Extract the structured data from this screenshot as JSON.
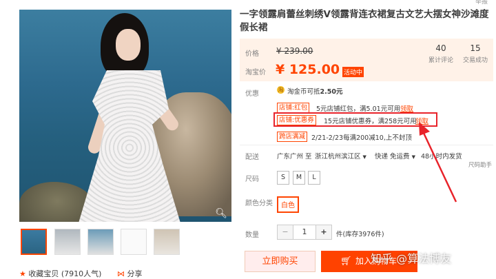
{
  "gallery": {
    "fav_label": "收藏宝贝 (7910人气)",
    "share_label": "分享",
    "thumbnails": [
      "thumb-1",
      "thumb-2",
      "thumb-3",
      "thumb-4",
      "thumb-5"
    ]
  },
  "product": {
    "title": "一字领露肩蕾丝刺绣V领露背连衣裙复古文艺大摆女神沙滩度假长裙",
    "price_label": "价格",
    "old_price": "¥ 239.00",
    "taobao_price_label": "淘宝价",
    "price": "¥ 125.00",
    "promo_badge": "活动中",
    "reviews_count": "40",
    "reviews_label": "累计评论",
    "trades_count": "15",
    "trades_label": "交易成功"
  },
  "benefits": {
    "label": "优惠",
    "coin_text_prefix": "淘金币可抵",
    "coin_value": "2.50元",
    "coupons": [
      {
        "tag": "店铺:红包",
        "text": "5元店铺红包，满5.01元可用",
        "link": "领取"
      },
      {
        "tag": "店铺:优惠券",
        "text": "15元店铺优惠券，满258元可用",
        "link": "领取"
      },
      {
        "tag": "跨店满减",
        "text": "2/21-2/23每满200减10,上不封顶"
      }
    ]
  },
  "delivery": {
    "label": "配送",
    "from": "广东广州 至",
    "to": "浙江杭州滨江区",
    "method": "快递 免运费",
    "time": "48小时内发货",
    "side_note": "尺码助手"
  },
  "size": {
    "label": "尺码",
    "options": [
      "S",
      "M",
      "L"
    ]
  },
  "color": {
    "label": "颜色分类",
    "selected": "白色"
  },
  "quantity": {
    "label": "数量",
    "minus": "−",
    "value": "1",
    "plus": "+",
    "stock": "件(库存3976件)"
  },
  "actions": {
    "buy_now": "立即购买",
    "add_to_cart": "加入购物车"
  },
  "top_fragment": "举报",
  "watermark": "知乎 @算法博友",
  "colors": {
    "accent": "#ff4400",
    "highlight_box": "#e8232a",
    "price_bg": "#fff2e8"
  }
}
